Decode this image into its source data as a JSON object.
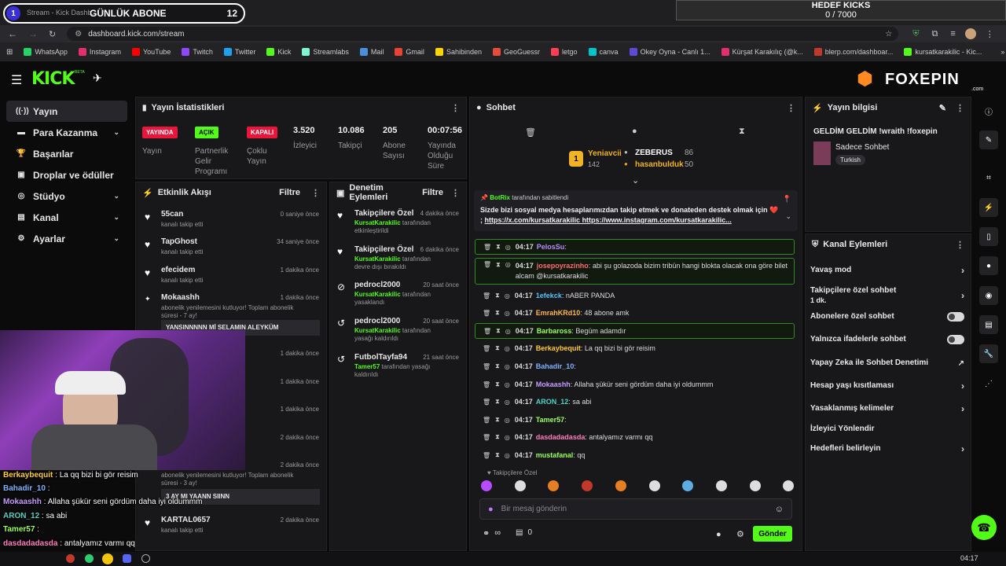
{
  "browser": {
    "tab_title": "Stream - Kick Dashb...",
    "url": "dashboard.kick.com/stream",
    "bookmarks": [
      "WhatsApp",
      "Instagram",
      "YouTube",
      "Twitch",
      "Twitter",
      "Kick",
      "Streamlabs",
      "Mail",
      "Gmail",
      "Sahibinden",
      "GeoGuessr",
      "letgo",
      "canva",
      "Okey Oyna - Canlı 1...",
      "Kürşat Karakılıç (@k...",
      "blerp.com/dashboar...",
      "kursatkarakilic - Kic..."
    ],
    "all_bookmarks": "Tüm Yer İşaretleri"
  },
  "overlay": {
    "sub_goal_count": "1",
    "sub_goal_label": "GÜNLÜK ABONE",
    "sub_goal_target": "12",
    "kick_goal_title": "HEDEF KICKS",
    "kick_goal_value": "0 / 7000",
    "kick_goal_progress": 0,
    "brand": "FOXEPIN",
    "brand_suffix": ".com"
  },
  "app": {
    "logo": "KICK",
    "logo_beta": "BETA"
  },
  "sidebar": [
    {
      "label": "Yayın",
      "icon": "broadcast-icon",
      "active": true
    },
    {
      "label": "Para Kazanma",
      "icon": "money-icon",
      "chevron": true
    },
    {
      "label": "Başarılar",
      "icon": "trophy-icon"
    },
    {
      "label": "Droplar ve ödüller",
      "icon": "gift-icon"
    },
    {
      "label": "Stüdyo",
      "icon": "studio-icon",
      "chevron": true
    },
    {
      "label": "Kanal",
      "icon": "channel-icon",
      "chevron": true
    },
    {
      "label": "Ayarlar",
      "icon": "gear-icon",
      "chevron": true
    }
  ],
  "stats": {
    "title": "Yayın İstatistikleri",
    "badges": [
      {
        "text": "YAYINDA",
        "label": "Yayın",
        "color": "#e9153b"
      },
      {
        "text": "AÇIK",
        "label": "Partnerlik Gelir Programı",
        "color": "#53fc18"
      },
      {
        "text": "KAPALI",
        "label": "Çoklu Yayın",
        "color": "#e9153b"
      }
    ],
    "numbers": [
      {
        "value": "3.520",
        "label": "İzleyici"
      },
      {
        "value": "10.086",
        "label": "Takipçi"
      },
      {
        "value": "205",
        "label": "Abone Sayısı"
      },
      {
        "value": "00:07:56",
        "label": "Yayında Olduğu Süre"
      }
    ]
  },
  "activity": {
    "title": "Etkinlik Akışı",
    "filter": "Filtre",
    "items": [
      {
        "name": "55can",
        "time": "0 saniye önce",
        "sub": "kanalı takip etti"
      },
      {
        "name": "TapGhost",
        "time": "34 saniye önce",
        "sub": "kanalı takip etti"
      },
      {
        "name": "efecidem",
        "time": "1 dakika önce",
        "sub": "kanalı takip etti"
      },
      {
        "name": "Mokaashh",
        "time": "1 dakika önce",
        "sub": "abonelik yenilemesini kutluyor! Toplam abonelik süresi - 7 ay!",
        "quote": "YANSINNNNN Mİ SELAMIN ALEYKÜM"
      },
      {
        "time": "1 dakika önce"
      },
      {
        "time": "1 dakika önce"
      },
      {
        "time": "1 dakika önce"
      },
      {
        "time": "2 dakika önce"
      },
      {
        "time": "2 dakika önce",
        "sub": "abonelik yenilemesini kutluyor! Toplam abonelik süresi - 3 ay!",
        "quote": "3 AY MI YAANN SIINN"
      },
      {
        "name": "KARTAL0657",
        "time": "2 dakika önce",
        "sub": "kanalı takip etti"
      }
    ]
  },
  "mod": {
    "title": "Denetim Eylemleri",
    "filter": "Filtre",
    "items": [
      {
        "name": "Takipçilere Özel",
        "time": "4 dakika önce",
        "by": "KursatKarakilic",
        "sub": " tarafından etkinleştirildi"
      },
      {
        "name": "Takipçilere Özel",
        "time": "6 dakika önce",
        "by": "KursatKarakilic",
        "sub": " tarafından devre dışı bırakıldı"
      },
      {
        "name": "pedrocl2000",
        "time": "20 saat önce",
        "by": "KursatKarakilic",
        "sub": " tarafından yasaklandı"
      },
      {
        "name": "pedrocl2000",
        "time": "20 saat önce",
        "by": "KursatKarakilic",
        "sub": " tarafından yasağı kaldırıldı"
      },
      {
        "name": "FutbolTayfa94",
        "time": "21 saat önce",
        "by": "Tamer57",
        "sub": " tarafından yasağı kaldırıldı"
      }
    ]
  },
  "chat": {
    "title": "Sohbet",
    "top": [
      {
        "rank": "1",
        "name": "Yeniavcii",
        "value": "142"
      },
      {
        "name": "ZEBERUS",
        "value": "86"
      },
      {
        "name": "hasanbulduk",
        "value": "50"
      }
    ],
    "pinned": {
      "by": "BotRix",
      "by_suffix": "tarafından sabitlendi",
      "text": "Sizde bizi sosyal medya hesaplarımızdan takip etmek ve donateden destek olmak için ❤️ ;",
      "links": "https://x.com/kursatkarakilic https://www.instagram.com/kursatkarakilic..."
    },
    "messages": [
      {
        "time": "04:17",
        "user": "PelosSu",
        "color": "#b58cff",
        "text": "",
        "hl": true
      },
      {
        "time": "04:17",
        "user": "josepoyrazinho",
        "color": "#ff6b6b",
        "text": "abi şu golazoda bizim tribün hangi blokta olacak ona göre bilet alcam @kursatkarakilic",
        "hl": true
      },
      {
        "time": "04:17",
        "user": "1efekck",
        "color": "#4fc3f7",
        "text": "nABER PANDA"
      },
      {
        "time": "04:17",
        "user": "EmrahKRd10",
        "color": "#ffb74d",
        "text": "48 abone amk"
      },
      {
        "time": "04:17",
        "user": "Barbaross",
        "color": "#9cff57",
        "text": "Begüm adamdır",
        "hl": true
      },
      {
        "time": "04:17",
        "user": "Berkaybequit",
        "color": "#ffcc33",
        "text": "La qq bizi bi gör reisim"
      },
      {
        "time": "04:17",
        "user": "Bahadir_10",
        "color": "#7fb2ff",
        "text": ""
      },
      {
        "time": "04:17",
        "user": "Mokaashh",
        "color": "#c59bff",
        "text": "Allaha şükür seni gördüm daha iyi oldummm"
      },
      {
        "time": "04:17",
        "user": "ARON_12",
        "color": "#4fd1c5",
        "text": "sa abi"
      },
      {
        "time": "04:17",
        "user": "Tamer57",
        "color": "#9cff57",
        "text": ""
      },
      {
        "time": "04:17",
        "user": "dasdadadasda",
        "color": "#ff7fbf",
        "text": "antalyamız varmı qq"
      },
      {
        "time": "04:17",
        "user": "mustafanal",
        "color": "#9cff57",
        "text": "qq"
      }
    ],
    "mode_label": "Takipçilere Özel",
    "placeholder": "Bir mesaj gönderin",
    "points": "∞",
    "stack": "0",
    "send": "Gönder"
  },
  "info": {
    "title": "Yayın bilgisi",
    "stream_title": "GELDİM GELDİM !wraith !foxepin",
    "category": "Sadece Sohbet",
    "language": "Turkish"
  },
  "channel_actions": {
    "title": "Kanal Eylemleri",
    "items": [
      {
        "label": "Yavaş mod",
        "type": "arrow"
      },
      {
        "label": "Takipçilere özel sohbet",
        "sub": "1 dk.",
        "type": "arrow"
      },
      {
        "label": "Abonelere özel sohbet",
        "type": "toggle"
      },
      {
        "label": "Yalnızca ifadelerle sohbet",
        "type": "toggle"
      },
      {
        "label": "Yapay Zeka ile Sohbet Denetimi",
        "type": "ext"
      },
      {
        "label": "Hesap yaşı kısıtlaması",
        "type": "arrow"
      },
      {
        "label": "Yasaklanmış kelimeler",
        "type": "arrow"
      },
      {
        "label": "İzleyici Yönlendir",
        "type": "none"
      },
      {
        "label": "Hedefleri belirleyin",
        "type": "arrow"
      }
    ]
  },
  "cam_chat": [
    {
      "user": "Berkaybequit",
      "text": "La qq bizi bi gör reisim",
      "color": "#ffcc33"
    },
    {
      "user": "Bahadir_10",
      "text": "",
      "color": "#7fb2ff"
    },
    {
      "user": "Mokaashh",
      "text": "Allaha şükür seni gördüm daha iyi oldummm",
      "color": "#c59bff"
    },
    {
      "user": "ARON_12",
      "text": "sa abi",
      "color": "#4fd1c5"
    },
    {
      "user": "Tamer57",
      "text": "",
      "color": "#9cff57"
    },
    {
      "user": "dasdadadasda",
      "text": "antalyamız varmı qq",
      "color": "#ff7fbf"
    },
    {
      "user": "mustafanal",
      "text": "qq",
      "color": "#9cff57"
    }
  ],
  "taskbar": {
    "clock": "04:17"
  }
}
